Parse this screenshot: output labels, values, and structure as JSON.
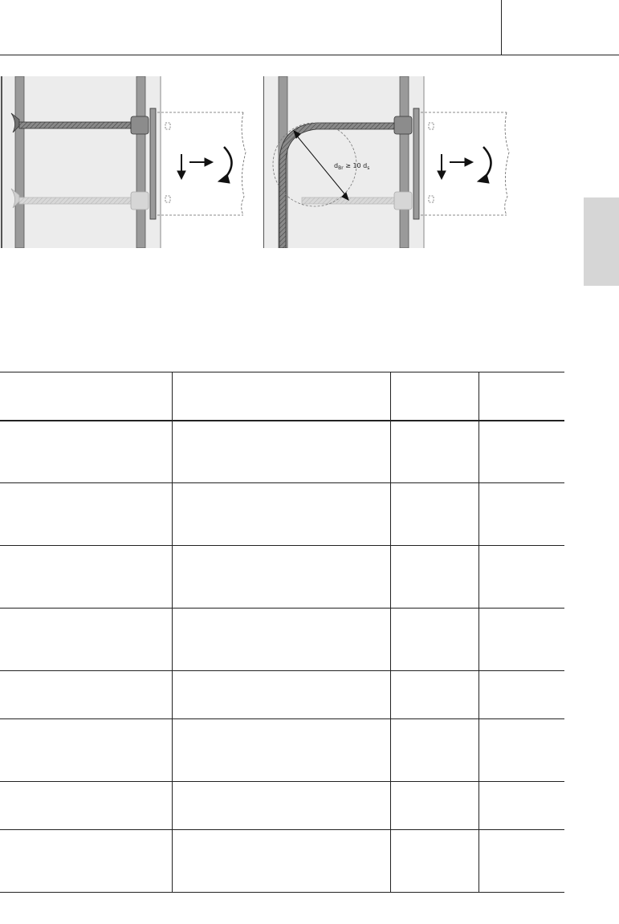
{
  "figures": {
    "right_label": "d",
    "right_label_sub1": "Br",
    "right_label_rest": " ≥ 10 d",
    "right_label_sub2": "s"
  },
  "table": {
    "headers": [
      "",
      "",
      "",
      ""
    ],
    "rows": [
      [
        "",
        "",
        "",
        ""
      ],
      [
        "",
        "",
        "",
        ""
      ],
      [
        "",
        "",
        "",
        ""
      ],
      [
        "",
        "",
        "",
        ""
      ],
      [
        "",
        "",
        "",
        ""
      ],
      [
        "",
        "",
        "",
        ""
      ],
      [
        "",
        "",
        "",
        ""
      ],
      [
        "",
        "",
        "",
        ""
      ]
    ]
  }
}
